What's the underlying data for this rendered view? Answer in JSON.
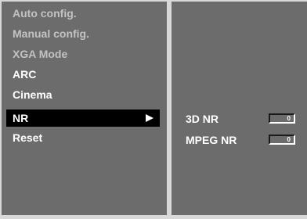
{
  "menu": {
    "items": [
      {
        "label": "Auto config.",
        "state": "disabled"
      },
      {
        "label": "Manual config.",
        "state": "disabled"
      },
      {
        "label": "XGA Mode",
        "state": "disabled"
      },
      {
        "label": "ARC",
        "state": "enabled"
      },
      {
        "label": "Cinema",
        "state": "enabled"
      },
      {
        "label": "NR",
        "state": "selected",
        "has_submenu": true
      },
      {
        "label": "Reset",
        "state": "enabled"
      }
    ]
  },
  "submenu": {
    "items": [
      {
        "label": "3D NR",
        "value": "0"
      },
      {
        "label": "MPEG NR",
        "value": "0"
      }
    ]
  },
  "colors": {
    "panel": "#6c6c6c",
    "frame": "#d8d8d8",
    "selected_bg": "#000000",
    "text": "#ffffff",
    "disabled_text": "#c3c3c3"
  },
  "icons": {
    "submenu_arrow": "triangle-right-icon"
  }
}
